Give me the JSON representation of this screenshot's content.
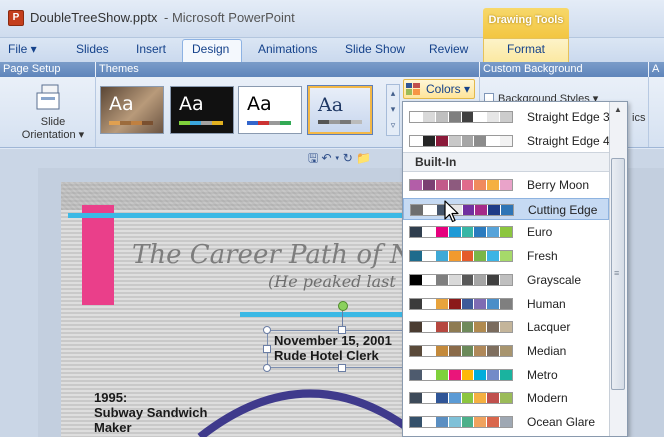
{
  "window": {
    "doc_title": "DoubleTreeShow.pptx",
    "app_title": "- Microsoft PowerPoint",
    "contextual_tab": "Drawing Tools"
  },
  "tabs": [
    "File ▾",
    "Slides",
    "Insert",
    "Design",
    "Animations",
    "Slide Show",
    "Review",
    "Format"
  ],
  "groups": {
    "page_setup": "Page Setup",
    "themes": "Themes",
    "custom_background": "Custom Background",
    "extra": "A"
  },
  "ribbon": {
    "slide_orientation_label": "Slide Orientation ▾",
    "colors_label": "Colors ▾",
    "background_styles_label": "Background Styles ▾",
    "ics_text": "ics",
    "theme_aa": "Aa"
  },
  "qat": "🖫 ↶ ▾ ↻ 📁",
  "slide": {
    "title": "The Career Path of N",
    "subtitle": "(He peaked last",
    "date_line1": "November 15, 2001",
    "date_line2": "Rude Hotel Clerk",
    "year_line1": "1995:",
    "year_line2": "Subway Sandwich",
    "year_line3": "Maker"
  },
  "colors_dropdown": {
    "custom": [
      {
        "name": "Straight Edge 3",
        "swatches": [
          "#ffffff",
          "#d9d9d9",
          "#bfbfbf",
          "#7f7f7f",
          "#404040",
          "#ffffff",
          "#e6e6e6",
          "#cccccc"
        ]
      },
      {
        "name": "Straight Edge 4",
        "swatches": [
          "#ffffff",
          "#262626",
          "#8b1a3a",
          "#c8c8c8",
          "#a6a6a6",
          "#8c8c8c",
          "#ffffff",
          "#f2f2f2"
        ]
      }
    ],
    "builtin_header": "Built-In",
    "builtin": [
      {
        "name": "Berry Moon",
        "swatches": [
          "#b35ea8",
          "#7b3f73",
          "#c25a8a",
          "#8d5a7e",
          "#e06b8c",
          "#f08a5d",
          "#f5b041",
          "#e9a3c9"
        ]
      },
      {
        "name": "Cutting Edge",
        "swatches": [
          "#6e6e6e",
          "#ffffff",
          "#44546a",
          "#e7e6e6",
          "#7030a0",
          "#a52a8a",
          "#1f3c88",
          "#2e75b6"
        ]
      },
      {
        "name": "Euro",
        "swatches": [
          "#2f3e4e",
          "#ffffff",
          "#e6007e",
          "#1f9ad6",
          "#37b6a6",
          "#2a7bbf",
          "#56a3d9",
          "#8cc63f"
        ]
      },
      {
        "name": "Fresh",
        "swatches": [
          "#1e6b8c",
          "#ffffff",
          "#3fa9d6",
          "#f29a2e",
          "#e45b2b",
          "#7ab648",
          "#3cb4e5",
          "#a6d96a"
        ]
      },
      {
        "name": "Grayscale",
        "swatches": [
          "#000000",
          "#ffffff",
          "#7f7f7f",
          "#d9d9d9",
          "#595959",
          "#a6a6a6",
          "#404040",
          "#bfbfbf"
        ]
      },
      {
        "name": "Human",
        "swatches": [
          "#3b3b3b",
          "#ffffff",
          "#e8a33c",
          "#8b1a1a",
          "#3d5a99",
          "#7f6cb3",
          "#4b8ec8",
          "#7f7f7f"
        ]
      },
      {
        "name": "Lacquer",
        "swatches": [
          "#4a3c31",
          "#ffffff",
          "#b6473f",
          "#8e7b52",
          "#6f8a5b",
          "#b08a4f",
          "#7a6b5d",
          "#c4b59a"
        ]
      },
      {
        "name": "Median",
        "swatches": [
          "#5a4a3a",
          "#ffffff",
          "#c48a3c",
          "#8a6b4a",
          "#6b8a5a",
          "#b0895a",
          "#7f6f5f",
          "#a8956f"
        ]
      },
      {
        "name": "Metro",
        "swatches": [
          "#4e5b6e",
          "#ffffff",
          "#7fd13b",
          "#ea157a",
          "#feb80a",
          "#00addc",
          "#738ac8",
          "#1ab39f"
        ]
      },
      {
        "name": "Modern",
        "swatches": [
          "#3d4a59",
          "#ffffff",
          "#2f5597",
          "#5b9bd5",
          "#8cc63f",
          "#f5b041",
          "#c0504d",
          "#9bbb59"
        ]
      },
      {
        "name": "Ocean Glare",
        "swatches": [
          "#35516b",
          "#ffffff",
          "#5b8fc2",
          "#7fc1d8",
          "#4cb08a",
          "#f0a35e",
          "#d9674c",
          "#9fa8b3"
        ]
      }
    ]
  }
}
